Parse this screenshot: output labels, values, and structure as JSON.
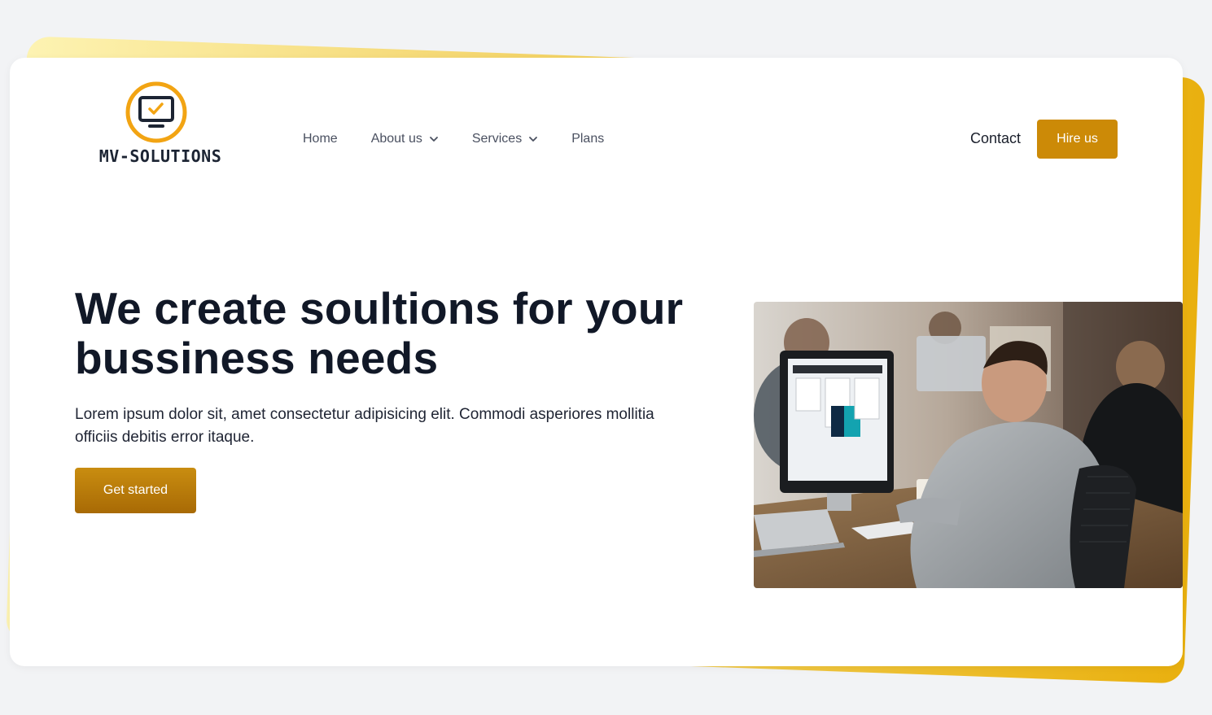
{
  "brand": {
    "name": "MV-SOLUTIONS",
    "primary_color": "#cc8a07",
    "logo_icon": "monitor-check-icon"
  },
  "nav": {
    "items": [
      {
        "label": "Home",
        "has_dropdown": false
      },
      {
        "label": "About us",
        "has_dropdown": true
      },
      {
        "label": "Services",
        "has_dropdown": true
      },
      {
        "label": "Plans",
        "has_dropdown": false
      }
    ]
  },
  "header": {
    "contact_label": "Contact",
    "hire_label": "Hire us"
  },
  "hero": {
    "title": "We create soultions for your bussiness needs",
    "text": "Lorem ipsum dolor sit, amet consectetur adipisicing elit. Commodi asperiores mollitia officiis debitis error itaque.",
    "cta_label": "Get started",
    "image_icon": "office-workers-photo"
  },
  "colors": {
    "page_bg": "#f2f3f5",
    "accent_gradient_start": "#fdf3b2",
    "accent_gradient_end": "#e9b00f",
    "heading": "#111827"
  }
}
